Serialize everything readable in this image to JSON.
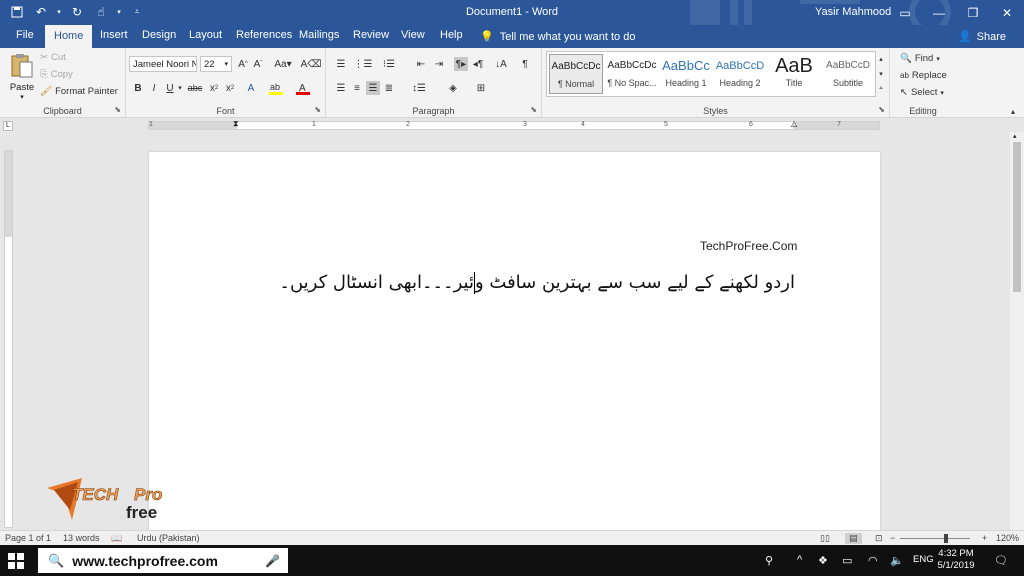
{
  "window": {
    "title": "Document1  -  Word",
    "user": "Yasir Mahmood",
    "controls": [
      "ribbon-display-icon",
      "minimize-icon",
      "restore-icon",
      "close-icon"
    ]
  },
  "tabs": [
    {
      "label": "File"
    },
    {
      "label": "Home"
    },
    {
      "label": "Insert"
    },
    {
      "label": "Design"
    },
    {
      "label": "Layout"
    },
    {
      "label": "References"
    },
    {
      "label": "Mailings"
    },
    {
      "label": "Review"
    },
    {
      "label": "View"
    },
    {
      "label": "Help"
    }
  ],
  "active_tab": "Home",
  "tellme": "Tell me what you want to do",
  "share": "Share",
  "clipboard": {
    "paste": "Paste",
    "cut": "Cut",
    "copy": "Copy",
    "format_painter": "Format Painter",
    "label": "Clipboard"
  },
  "font": {
    "name": "Jameel Noori N",
    "size": "22",
    "label": "Font"
  },
  "paragraph": {
    "label": "Paragraph"
  },
  "styles": {
    "label": "Styles",
    "items": [
      {
        "sample": "AaBbCcDc",
        "name": "¶ Normal"
      },
      {
        "sample": "AaBbCcDc",
        "name": "¶ No Spac..."
      },
      {
        "sample": "AaBbCc",
        "name": "Heading 1"
      },
      {
        "sample": "AaBbCcD",
        "name": "Heading 2"
      },
      {
        "sample": "AaB",
        "name": "Title"
      },
      {
        "sample": "AaBbCcD",
        "name": "Subtitle"
      }
    ]
  },
  "editing": {
    "find": "Find",
    "replace": "Replace",
    "select": "Select",
    "label": "Editing"
  },
  "ruler": {
    "numbers": [
      "1",
      "1",
      "2",
      "3",
      "4",
      "5",
      "6",
      "7"
    ]
  },
  "document": {
    "heading": "TechProFree.Com",
    "urdu_before_cursor": "اردو لکھنے کے لیے سب سے بہترین سافٹ و",
    "urdu_after_cursor": "ئیر۔۔۔ابھی انسٹال کریں۔"
  },
  "logo": {
    "text_tech": "TECH",
    "text_pro": "Pro",
    "text_free": "free"
  },
  "statusbar": {
    "page": "Page 1 of 1",
    "words": "13 words",
    "language": "Urdu (Pakistan)",
    "zoom": "120%"
  },
  "taskbar": {
    "search_text": "www.techprofree.com",
    "lang": "ENG",
    "time": "4:32 PM",
    "date": "5/1/2019"
  }
}
